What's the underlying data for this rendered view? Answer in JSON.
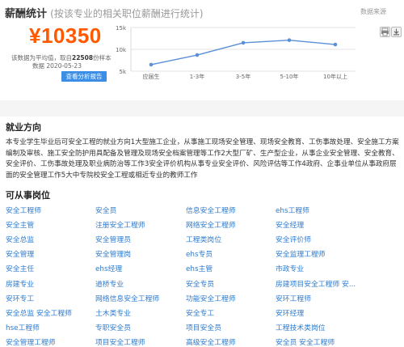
{
  "header": {
    "title": "薪酬统计",
    "subtitle": "(按该专业的相关职位薪酬进行统计)",
    "source_link": "数据来源"
  },
  "summary": {
    "salary": "¥10350",
    "note_prefix": "该数据为平均值，取自",
    "sample_count": "22508",
    "note_suffix": "份样本",
    "date": "数据 2020-05-23",
    "button": "查看分析报告"
  },
  "toolbar": {
    "print_icon": "print-icon",
    "download_icon": "download-icon"
  },
  "chart_data": {
    "type": "line",
    "categories": [
      "应届生",
      "1-3年",
      "3-5年",
      "5-10年",
      "10年以上"
    ],
    "values": [
      6500,
      8700,
      11500,
      12100,
      11100
    ],
    "ylim": [
      5000,
      15000
    ],
    "yticks": [
      5000,
      10000,
      15000
    ],
    "ytick_labels": [
      "5k",
      "10k",
      "15k"
    ],
    "grid": true,
    "color": "#5b8fd6"
  },
  "direction": {
    "title": "就业方向",
    "text": "本专业学生毕业后可安全工程的就业方向1大型施工企业，从事施工现场安全管理、现场安全教育、工伤事故处理、安全施工方案编制及审核、施工安全防护用具配备及管理及现场安全档案管理等工作2大型厂矿、生产型企业，从事企业安全管理、安全教育、安全评价、工伤事故处理及职业病防治等工作3安全评价机构从事专业安全评价、风险评估等工作4政府、企事业单位从事政府层面的安全管理工作5大中专院校安全工程或相近专业的教师工作"
  },
  "positions": {
    "title": "可从事岗位",
    "items": [
      "安全工程师",
      "安全员",
      "信息安全工程师",
      "ehs工程师",
      "安全主管",
      "注册安全工程师",
      "网络安全工程师",
      "安全经理",
      "安全总监",
      "安全管理员",
      "工程类岗位",
      "安全评价师",
      "安全管理",
      "安全管理岗",
      "ehs专员",
      "安全监理工程师",
      "安全主任",
      "ehs经理",
      "ehs主管",
      "市政专业",
      "房建专业",
      "道桥专业",
      "安全专员",
      "房建项目安全工程师 安...",
      "安环专工",
      "网络信息安全工程师",
      "功能安全工程师",
      "安环工程师",
      "安全总监 安全工程师",
      "土木类专业",
      "安全专工",
      "安环经理",
      "hse工程师",
      "专职安全员",
      "项目安全员",
      "工程技术类岗位",
      "安全管理工程师",
      "项目安全工程师",
      "高级安全工程师",
      "安全员 安全工程师"
    ]
  }
}
